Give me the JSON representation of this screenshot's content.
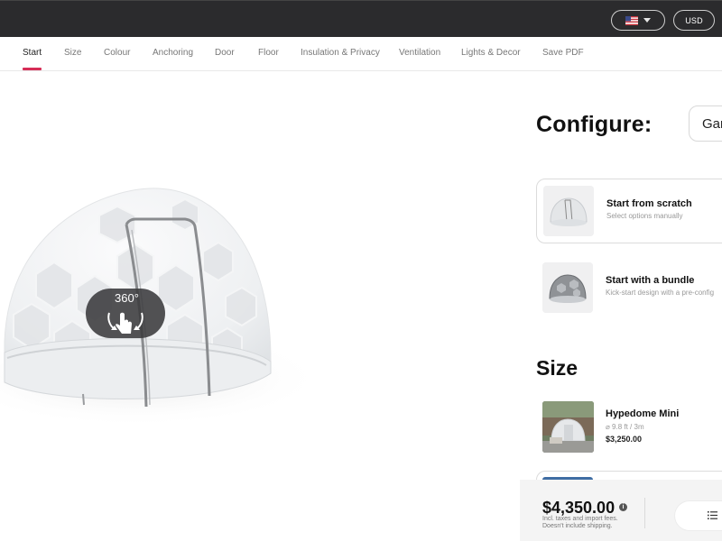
{
  "header": {
    "locale_icon": "us-flag-icon",
    "currency": "USD"
  },
  "tabs": [
    {
      "label": "Start",
      "active": true
    },
    {
      "label": "Size"
    },
    {
      "label": "Colour"
    },
    {
      "label": "Anchoring"
    },
    {
      "label": "Door"
    },
    {
      "label": "Floor"
    },
    {
      "label": "Insulation & Privacy"
    },
    {
      "label": "Ventilation"
    },
    {
      "label": "Lights & Decor"
    },
    {
      "label": "Save PDF"
    }
  ],
  "viewer": {
    "rotate_label": "360°",
    "rotate_icon": "rotate-360-hand-icon"
  },
  "configure": {
    "heading": "Configure:",
    "select_value": "Gar",
    "options": [
      {
        "title": "Start from scratch",
        "subtitle": "Select options manually",
        "selected": true
      },
      {
        "title": "Start with a bundle",
        "subtitle": "Kick-start design with a pre-config"
      }
    ]
  },
  "size": {
    "heading": "Size",
    "items": [
      {
        "title": "Hypedome Mini",
        "subtitle": "⌀ 9.8 ft / 3m",
        "price": "$3,250.00"
      }
    ]
  },
  "pricebar": {
    "total": "$4,350.00",
    "note_line1": "Incl. taxes and import fees.",
    "note_line2": "Doesn't include shipping.",
    "info_icon": "info-icon",
    "summary_icon": "list-icon"
  },
  "colors": {
    "accent": "#d62d57",
    "topbar": "#2b2b2d"
  }
}
